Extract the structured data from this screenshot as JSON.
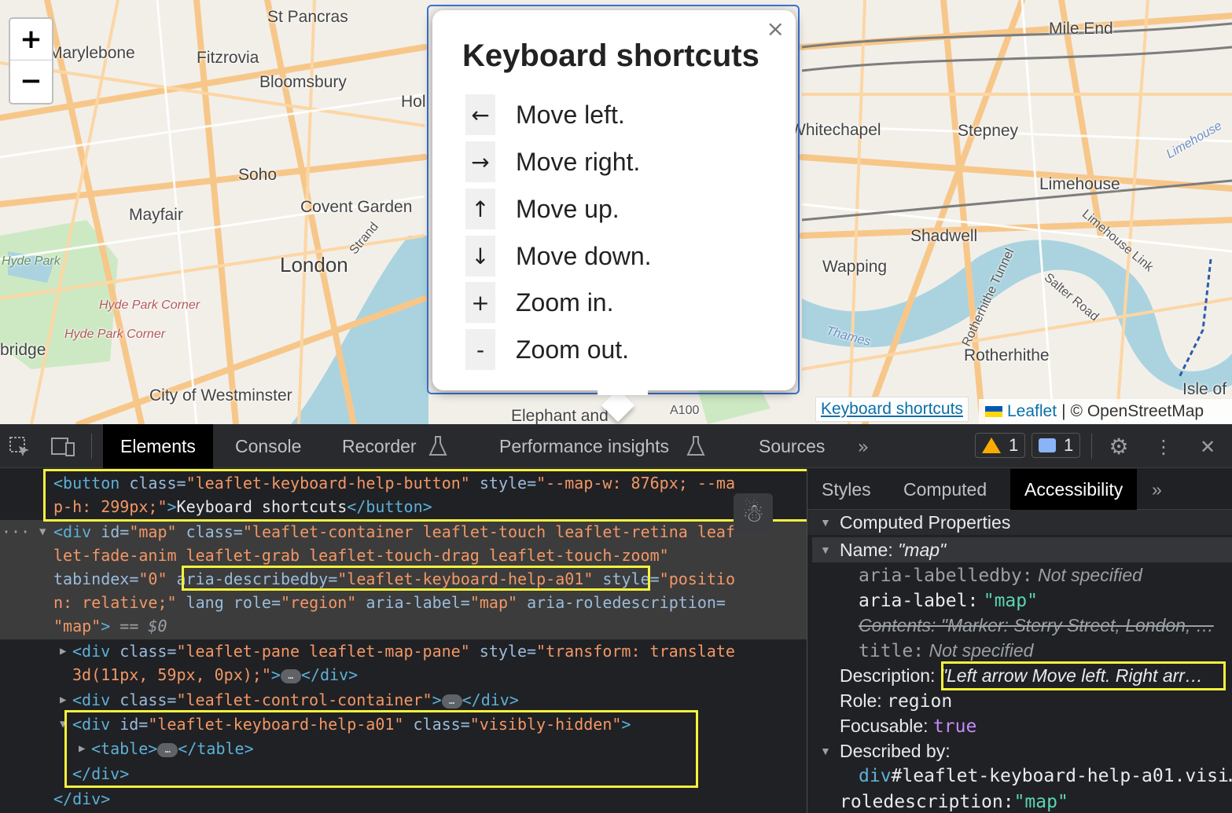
{
  "map": {
    "zoom_in_label": "+",
    "zoom_out_label": "−",
    "places": [
      "St Pancras",
      "Marylebone",
      "Fitzrovia",
      "Bloomsbury",
      "Hol",
      "Soho",
      "Mayfair",
      "Covent Garden",
      "Strand",
      "London",
      "Hyde Park",
      "Hyde Park Corner",
      "Hyde Park Corner",
      "bridge",
      "City of Westminster",
      "Elephant and",
      "A100",
      "Mile End",
      "Whitechapel",
      "Stepney",
      "Limehouse",
      "Shadwell",
      "Wapping",
      "Rotherhithe",
      "Isle of",
      "Salter Road",
      "Limehouse",
      "Rotherhithe Tunnel",
      "Limehouse Link",
      "Thames"
    ],
    "attribution_kb": "Keyboard shortcuts",
    "attribution_leaflet": "Leaflet",
    "attribution_sep": "|",
    "attribution_osm": "© OpenStreetMap"
  },
  "help": {
    "title": "Keyboard shortcuts",
    "close": "×",
    "rows": [
      {
        "key": "←",
        "desc": "Move left."
      },
      {
        "key": "→",
        "desc": "Move right."
      },
      {
        "key": "↑",
        "desc": "Move up."
      },
      {
        "key": "↓",
        "desc": "Move down."
      },
      {
        "key": "+",
        "desc": "Zoom in."
      },
      {
        "key": "-",
        "desc": "Zoom out."
      }
    ]
  },
  "devtools": {
    "tabs": [
      "Elements",
      "Console",
      "Recorder",
      "Performance insights",
      "Sources"
    ],
    "active_tab": "Elements",
    "warning_count": "1",
    "message_count": "1",
    "side_tabs": [
      "Styles",
      "Computed",
      "Accessibility"
    ],
    "side_active": "Accessibility"
  },
  "code": {
    "l1": [
      "<button",
      " class=",
      "\"leaflet-keyboard-help-button\"",
      " style=",
      "\"--map-w: 876px; --ma"
    ],
    "l2": [
      "p-h: 299px;\"",
      ">",
      "Keyboard shortcuts",
      "</button>"
    ],
    "l3": [
      "<div",
      " id=",
      "\"map\"",
      " class=",
      "\"leaflet-container leaflet-touch leaflet-retina leaf"
    ],
    "l4": "let-fade-anim leaflet-grab leaflet-touch-drag leaflet-touch-zoom\"",
    "l5": [
      "tabindex=",
      "\"0\"",
      "aria-describedby=",
      "\"leaflet-keyboard-help-a01\"",
      " style=",
      "\"positio"
    ],
    "l6": [
      "n: relative;\"",
      " lang",
      " role=",
      "\"region\"",
      " aria-label=",
      "\"map\"",
      " aria-roledescription="
    ],
    "l7": [
      "\"map\"",
      ">",
      " == $0"
    ],
    "l8": [
      "<div",
      " class=",
      "\"leaflet-pane leaflet-map-pane\"",
      " style=",
      "\"transform: translate"
    ],
    "l9": [
      "3d(11px, 59px, 0px);\"",
      ">",
      "</div>"
    ],
    "l10": [
      "<div",
      " class=",
      "\"leaflet-control-container\"",
      ">",
      "</div>"
    ],
    "l11": [
      "<div",
      " id=",
      "\"leaflet-keyboard-help-a01\"",
      " class=",
      "\"visibly-hidden\"",
      ">"
    ],
    "l12": [
      "<table>",
      "</table>"
    ],
    "l13": "</div>",
    "l14": "</div>",
    "ellipsis": "…"
  },
  "accessibility": {
    "section": "Computed Properties",
    "name_key": "Name:",
    "name_val": "\"map\"",
    "labelledby_key": "aria-labelledby:",
    "labelledby_val": "Not specified",
    "label_key": "aria-label:",
    "label_val": "\"map\"",
    "contents_text": "Contents: \"Marker: Sterry Street, London, …",
    "title_key": "title:",
    "title_val": "Not specified",
    "desc_key": "Description:",
    "desc_val": "\"Left arrow Move left. Right arr…",
    "role_key": "Role:",
    "role_val": "region",
    "focus_key": "Focusable:",
    "focus_val": "true",
    "described_key": "Described by:",
    "described_tag": "div",
    "described_val": "#leaflet-keyboard-help-a01.visi…",
    "roledesc_key": "roledescription:",
    "roledesc_val": "\"map\""
  },
  "colors": {
    "highlight": "#f6f23c",
    "popup_border": "#3b73d6",
    "link": "#0a6fa8"
  }
}
